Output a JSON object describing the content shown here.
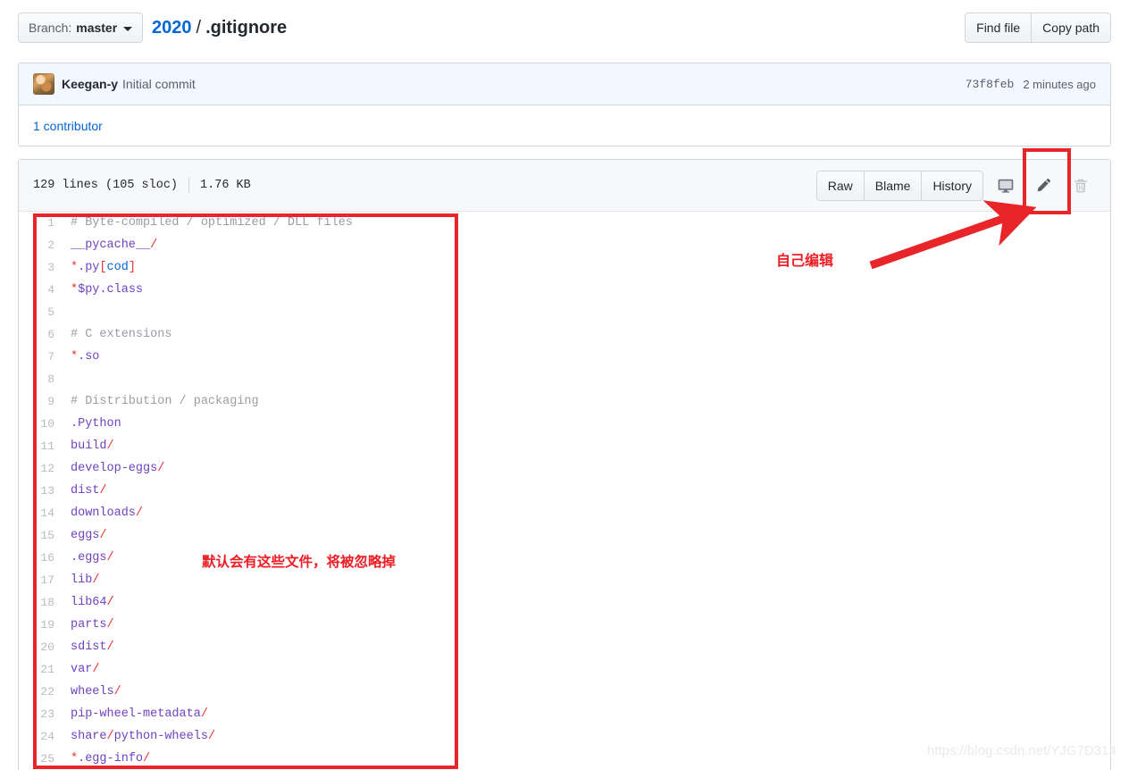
{
  "topbar": {
    "branch_label": "Branch:",
    "branch_value": "master",
    "breadcrumb": {
      "repo": "2020",
      "separator": "/",
      "filename": ".gitignore"
    },
    "actions": [
      {
        "label": "Find file",
        "name": "find-file-button"
      },
      {
        "label": "Copy path",
        "name": "copy-path-button"
      }
    ]
  },
  "commit": {
    "author": "Keegan-y",
    "message": "Initial commit",
    "sha": "73f8feb",
    "time": "2 minutes ago",
    "contributors": "1 contributor"
  },
  "file": {
    "lines_info": "129 lines (105 sloc)",
    "size": "1.76 KB",
    "actions": [
      {
        "label": "Raw",
        "name": "raw-button"
      },
      {
        "label": "Blame",
        "name": "blame-button"
      },
      {
        "label": "History",
        "name": "history-button"
      }
    ],
    "icons": [
      {
        "name": "desktop-icon",
        "title": "Open this file in GitHub Desktop"
      },
      {
        "name": "pencil-edit-icon",
        "title": "Edit this file"
      },
      {
        "name": "trash-delete-icon",
        "title": "Delete this file"
      }
    ]
  },
  "code": {
    "language": "gitignore",
    "lines": [
      {
        "n": 1,
        "tokens": [
          {
            "t": "# Byte-compiled / optimized / DLL files",
            "c": "c-comment"
          }
        ]
      },
      {
        "n": 2,
        "tokens": [
          {
            "t": "__pycache__",
            "c": "c-purple"
          },
          {
            "t": "/",
            "c": "c-red"
          }
        ]
      },
      {
        "n": 3,
        "tokens": [
          {
            "t": "*",
            "c": "c-red"
          },
          {
            "t": ".py",
            "c": "c-purple"
          },
          {
            "t": "[",
            "c": "c-red"
          },
          {
            "t": "cod",
            "c": "c-blue"
          },
          {
            "t": "]",
            "c": "c-red"
          }
        ]
      },
      {
        "n": 4,
        "tokens": [
          {
            "t": "*",
            "c": "c-red"
          },
          {
            "t": "$py.class",
            "c": "c-purple"
          }
        ]
      },
      {
        "n": 5,
        "tokens": []
      },
      {
        "n": 6,
        "tokens": [
          {
            "t": "# C extensions",
            "c": "c-comment"
          }
        ]
      },
      {
        "n": 7,
        "tokens": [
          {
            "t": "*",
            "c": "c-red"
          },
          {
            "t": ".so",
            "c": "c-purple"
          }
        ]
      },
      {
        "n": 8,
        "tokens": []
      },
      {
        "n": 9,
        "tokens": [
          {
            "t": "# Distribution / packaging",
            "c": "c-comment"
          }
        ]
      },
      {
        "n": 10,
        "tokens": [
          {
            "t": ".Python",
            "c": "c-purple"
          }
        ]
      },
      {
        "n": 11,
        "tokens": [
          {
            "t": "build",
            "c": "c-purple"
          },
          {
            "t": "/",
            "c": "c-red"
          }
        ]
      },
      {
        "n": 12,
        "tokens": [
          {
            "t": "develop-eggs",
            "c": "c-purple"
          },
          {
            "t": "/",
            "c": "c-red"
          }
        ]
      },
      {
        "n": 13,
        "tokens": [
          {
            "t": "dist",
            "c": "c-purple"
          },
          {
            "t": "/",
            "c": "c-red"
          }
        ]
      },
      {
        "n": 14,
        "tokens": [
          {
            "t": "downloads",
            "c": "c-purple"
          },
          {
            "t": "/",
            "c": "c-red"
          }
        ]
      },
      {
        "n": 15,
        "tokens": [
          {
            "t": "eggs",
            "c": "c-purple"
          },
          {
            "t": "/",
            "c": "c-red"
          }
        ]
      },
      {
        "n": 16,
        "tokens": [
          {
            "t": ".eggs",
            "c": "c-purple"
          },
          {
            "t": "/",
            "c": "c-red"
          }
        ]
      },
      {
        "n": 17,
        "tokens": [
          {
            "t": "lib",
            "c": "c-purple"
          },
          {
            "t": "/",
            "c": "c-red"
          }
        ]
      },
      {
        "n": 18,
        "tokens": [
          {
            "t": "lib64",
            "c": "c-purple"
          },
          {
            "t": "/",
            "c": "c-red"
          }
        ]
      },
      {
        "n": 19,
        "tokens": [
          {
            "t": "parts",
            "c": "c-purple"
          },
          {
            "t": "/",
            "c": "c-red"
          }
        ]
      },
      {
        "n": 20,
        "tokens": [
          {
            "t": "sdist",
            "c": "c-purple"
          },
          {
            "t": "/",
            "c": "c-red"
          }
        ]
      },
      {
        "n": 21,
        "tokens": [
          {
            "t": "var",
            "c": "c-purple"
          },
          {
            "t": "/",
            "c": "c-red"
          }
        ]
      },
      {
        "n": 22,
        "tokens": [
          {
            "t": "wheels",
            "c": "c-purple"
          },
          {
            "t": "/",
            "c": "c-red"
          }
        ]
      },
      {
        "n": 23,
        "tokens": [
          {
            "t": "pip-wheel-metadata",
            "c": "c-purple"
          },
          {
            "t": "/",
            "c": "c-red"
          }
        ]
      },
      {
        "n": 24,
        "tokens": [
          {
            "t": "share",
            "c": "c-purple"
          },
          {
            "t": "/",
            "c": "c-red"
          },
          {
            "t": "python-wheels",
            "c": "c-purple"
          },
          {
            "t": "/",
            "c": "c-red"
          }
        ]
      },
      {
        "n": 25,
        "tokens": [
          {
            "t": "*",
            "c": "c-red"
          },
          {
            "t": ".egg-info",
            "c": "c-purple"
          },
          {
            "t": "/",
            "c": "c-red"
          }
        ]
      }
    ]
  },
  "annotations": {
    "edit_note": "自己编辑",
    "files_note": "默认会有这些文件，将被忽略掉",
    "color": "#ee1c24"
  },
  "watermark": "https://blog.csdn.net/YJG7D314"
}
